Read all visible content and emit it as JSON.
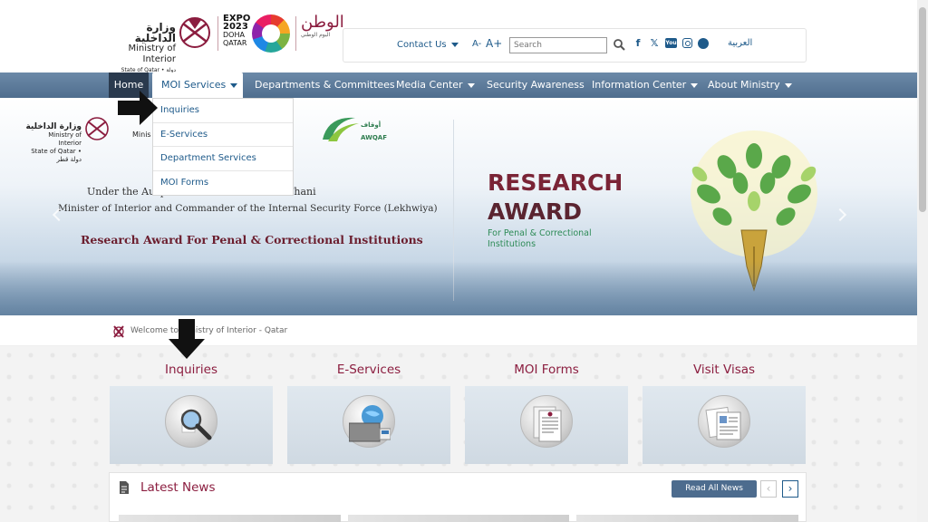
{
  "header": {
    "logo_ar": "وزارة الداخلية",
    "logo_en": "Ministry of Interior",
    "logo_state": "State of Qatar • دولة قطر",
    "expo": [
      "EXPO",
      "2023",
      "DOHA",
      "QATAR"
    ],
    "calligraphy": "الوطن",
    "calligraphy_sub": "اليوم الوطني",
    "contact_label": "Contact Us",
    "font_decrease": "A-",
    "font_increase": "A+",
    "search_placeholder": "Search",
    "socials": [
      "f",
      "𝕏",
      "You",
      "ig",
      "sc"
    ],
    "arabic_link": "العربية"
  },
  "nav": {
    "items": [
      {
        "label": "Home"
      },
      {
        "label": "MOI Services"
      },
      {
        "label": "Departments & Committees"
      },
      {
        "label": "Media Center"
      },
      {
        "label": "Security Awareness"
      },
      {
        "label": "Information Center"
      },
      {
        "label": "About Ministry"
      }
    ],
    "dropdown": [
      "Inquiries",
      "E-Services",
      "Department Services",
      "MOI Forms"
    ]
  },
  "banner": {
    "logo_ar": "وزارة الداخلية",
    "logo_en": "Ministry of Interior",
    "logo_state": "State of Qatar • دولة قطر",
    "moi_fragment": "Minis",
    "awqaf_ar": "أوقاف",
    "awqaf_en": "AWQAF",
    "patron_line1": "Under the Auspices of … bin Khalifa Al Thani",
    "patron_line2": "Minister of Interior and Commander of the Internal Security Force (Lekhwiya)",
    "subtitle": "Research Award For Penal & Correctional Institutions",
    "award_title_1": "RESEARCH",
    "award_title_2": "AWARD",
    "award_sub_1": "For Penal & Correctional",
    "award_sub_2": "Institutions"
  },
  "breadcrumb": {
    "text": "Welcome to Ministry of Interior - Qatar"
  },
  "services": [
    {
      "title": "Inquiries",
      "icon": "magnifier-icon"
    },
    {
      "title": "E-Services",
      "icon": "computer-icon"
    },
    {
      "title": "MOI Forms",
      "icon": "documents-icon"
    },
    {
      "title": "Visit Visas",
      "icon": "visa-papers-icon"
    }
  ],
  "news": {
    "title": "Latest News",
    "read_all": "Read All News",
    "prev": "‹",
    "next": "›"
  },
  "colors": {
    "brand_maroon": "#8b1d3f",
    "link_blue": "#1e5a8a",
    "nav_bg": "#5b7a9a",
    "button_blue": "#4d6c8e"
  }
}
